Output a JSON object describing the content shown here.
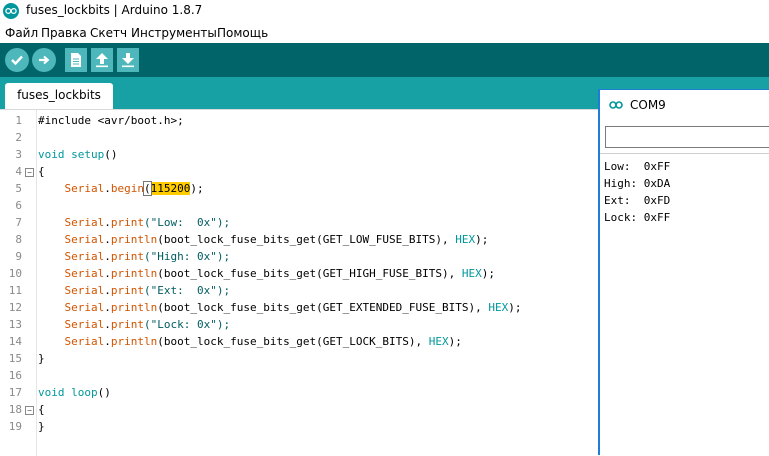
{
  "window": {
    "title": "fuses_lockbits | Arduino 1.8.7"
  },
  "menu": [
    "Файл",
    "Правка",
    "Скетч",
    "Инструменты",
    "Помощь"
  ],
  "toolbar": [
    "verify-icon",
    "upload-icon",
    "new-icon",
    "open-icon",
    "save-icon"
  ],
  "tabs": [
    {
      "label": "fuses_lockbits"
    }
  ],
  "editor": {
    "line_numbers": [
      "1",
      "2",
      "3",
      "4",
      "5",
      "6",
      "7",
      "8",
      "9",
      "10",
      "11",
      "12",
      "13",
      "14",
      "15",
      "16",
      "17",
      "18",
      "19"
    ],
    "lines": [
      [
        {
          "t": "#include <avr/boot.h>;",
          "c": ""
        }
      ],
      [],
      [
        {
          "t": "void",
          "c": "kw"
        },
        {
          "t": " ",
          "c": ""
        },
        {
          "t": "setup",
          "c": "kw"
        },
        {
          "t": "()",
          "c": ""
        }
      ],
      [
        {
          "t": "{",
          "c": ""
        }
      ],
      [
        {
          "t": "    ",
          "c": ""
        },
        {
          "t": "Serial",
          "c": "fn"
        },
        {
          "t": ".",
          "c": ""
        },
        {
          "t": "begin",
          "c": "fn"
        },
        {
          "t": "(",
          "c": "brace-hl"
        },
        {
          "t": "115200",
          "c": "hl"
        },
        {
          "t": ");",
          "c": ""
        }
      ],
      [],
      [
        {
          "t": "    ",
          "c": ""
        },
        {
          "t": "Serial",
          "c": "fn"
        },
        {
          "t": ".",
          "c": ""
        },
        {
          "t": "print",
          "c": "fn"
        },
        {
          "t": "(\"Low:  0x\");",
          "c": "str"
        }
      ],
      [
        {
          "t": "    ",
          "c": ""
        },
        {
          "t": "Serial",
          "c": "fn"
        },
        {
          "t": ".",
          "c": ""
        },
        {
          "t": "println",
          "c": "fn"
        },
        {
          "t": "(boot_lock_fuse_bits_get(GET_LOW_FUSE_BITS), ",
          "c": ""
        },
        {
          "t": "HEX",
          "c": "const"
        },
        {
          "t": ");",
          "c": ""
        }
      ],
      [
        {
          "t": "    ",
          "c": ""
        },
        {
          "t": "Serial",
          "c": "fn"
        },
        {
          "t": ".",
          "c": ""
        },
        {
          "t": "print",
          "c": "fn"
        },
        {
          "t": "(\"High: 0x\");",
          "c": "str"
        }
      ],
      [
        {
          "t": "    ",
          "c": ""
        },
        {
          "t": "Serial",
          "c": "fn"
        },
        {
          "t": ".",
          "c": ""
        },
        {
          "t": "println",
          "c": "fn"
        },
        {
          "t": "(boot_lock_fuse_bits_get(GET_HIGH_FUSE_BITS), ",
          "c": ""
        },
        {
          "t": "HEX",
          "c": "const"
        },
        {
          "t": ");",
          "c": ""
        }
      ],
      [
        {
          "t": "    ",
          "c": ""
        },
        {
          "t": "Serial",
          "c": "fn"
        },
        {
          "t": ".",
          "c": ""
        },
        {
          "t": "print",
          "c": "fn"
        },
        {
          "t": "(\"Ext:  0x\");",
          "c": "str"
        }
      ],
      [
        {
          "t": "    ",
          "c": ""
        },
        {
          "t": "Serial",
          "c": "fn"
        },
        {
          "t": ".",
          "c": ""
        },
        {
          "t": "println",
          "c": "fn"
        },
        {
          "t": "(boot_lock_fuse_bits_get(GET_EXTENDED_FUSE_BITS), ",
          "c": ""
        },
        {
          "t": "HEX",
          "c": "const"
        },
        {
          "t": ");",
          "c": ""
        }
      ],
      [
        {
          "t": "    ",
          "c": ""
        },
        {
          "t": "Serial",
          "c": "fn"
        },
        {
          "t": ".",
          "c": ""
        },
        {
          "t": "print",
          "c": "fn"
        },
        {
          "t": "(\"Lock: 0x\");",
          "c": "str"
        }
      ],
      [
        {
          "t": "    ",
          "c": ""
        },
        {
          "t": "Serial",
          "c": "fn"
        },
        {
          "t": ".",
          "c": ""
        },
        {
          "t": "println",
          "c": "fn"
        },
        {
          "t": "(boot_lock_fuse_bits_get(GET_LOCK_BITS), ",
          "c": ""
        },
        {
          "t": "HEX",
          "c": "const"
        },
        {
          "t": ");",
          "c": ""
        }
      ],
      [
        {
          "t": "}",
          "c": ""
        }
      ],
      [],
      [
        {
          "t": "void",
          "c": "kw"
        },
        {
          "t": " ",
          "c": ""
        },
        {
          "t": "loop",
          "c": "kw"
        },
        {
          "t": "()",
          "c": ""
        }
      ],
      [
        {
          "t": "{",
          "c": ""
        }
      ],
      [
        {
          "t": "}",
          "c": ""
        }
      ]
    ],
    "fold_markers": [
      "⊟",
      "⊟"
    ]
  },
  "serial_monitor": {
    "title": "COM9",
    "input_value": "",
    "output": [
      "Low:  0xFF",
      "High: 0xDA",
      "Ext:  0xFD",
      "Lock: 0xFF"
    ]
  },
  "colors": {
    "toolbar_bg": "#006468",
    "tabstrip_bg": "#17a1a5",
    "button": "#4db7bb",
    "keyword": "#00979c",
    "function": "#d35400",
    "highlight": "#ffcc00"
  }
}
